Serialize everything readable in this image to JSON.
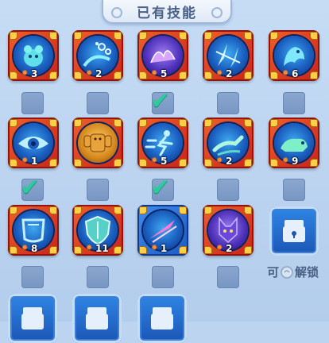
{
  "title": "已有技能",
  "skills": [
    {
      "icon": "water-beast-icon",
      "count": "3",
      "checked": false
    },
    {
      "icon": "water-bubbles-icon",
      "count": "2",
      "checked": false
    },
    {
      "icon": "claw-icon",
      "count": "5",
      "checked": true
    },
    {
      "icon": "ice-shards-icon",
      "count": "2",
      "checked": false
    },
    {
      "icon": "dragon-spirit-icon",
      "count": "6",
      "checked": false
    },
    {
      "icon": "eye-icon",
      "count": "1",
      "checked": true
    },
    {
      "icon": "golem-icon",
      "count": "",
      "checked": false
    },
    {
      "icon": "dash-runner-icon",
      "count": "5",
      "checked": true
    },
    {
      "icon": "hand-wave-icon",
      "count": "2",
      "checked": false
    },
    {
      "icon": "tiger-icon",
      "count": "9",
      "checked": false
    },
    {
      "icon": "armor-icon",
      "count": "8",
      "checked": false
    },
    {
      "icon": "shield-icon",
      "count": "11",
      "checked": false
    },
    {
      "icon": "pink-slash-icon",
      "count": "1",
      "checked": false
    },
    {
      "icon": "fox-icon",
      "count": "2",
      "checked": false
    }
  ],
  "unlock_hint": {
    "prefix": "可",
    "suffix": "解锁"
  }
}
